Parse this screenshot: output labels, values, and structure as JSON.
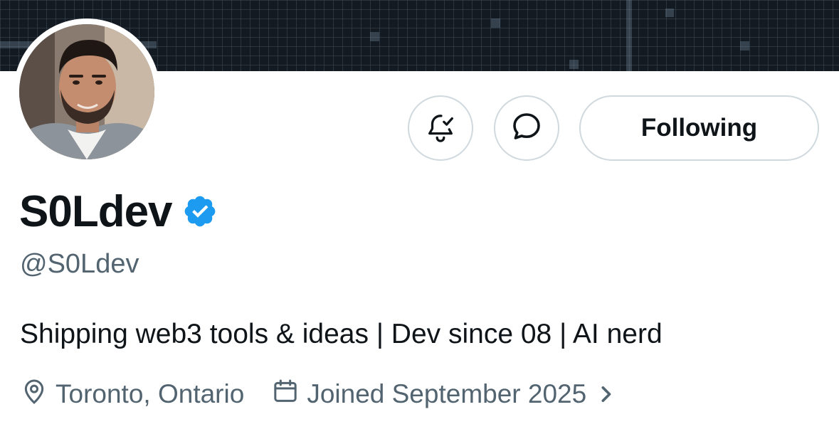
{
  "profile": {
    "display_name": "S0Ldev",
    "handle": "@S0Ldev",
    "bio": "Shipping web3 tools & ideas | Dev since 08 | AI nerd",
    "location": "Toronto, Ontario",
    "joined": "Joined September 2025",
    "verified": true
  },
  "actions": {
    "notify_icon": "bell-check-icon",
    "message_icon": "message-bubble-icon",
    "follow_label": "Following"
  },
  "icons": {
    "location": "location-pin-icon",
    "joined": "calendar-icon",
    "expand": "chevron-right-icon",
    "verified": "verified-badge-icon"
  },
  "colors": {
    "verified_blue": "#1d9bf0",
    "primary_text": "#0f1419",
    "secondary_text": "#536471",
    "border": "#cfd9de",
    "banner": "#131a22"
  }
}
